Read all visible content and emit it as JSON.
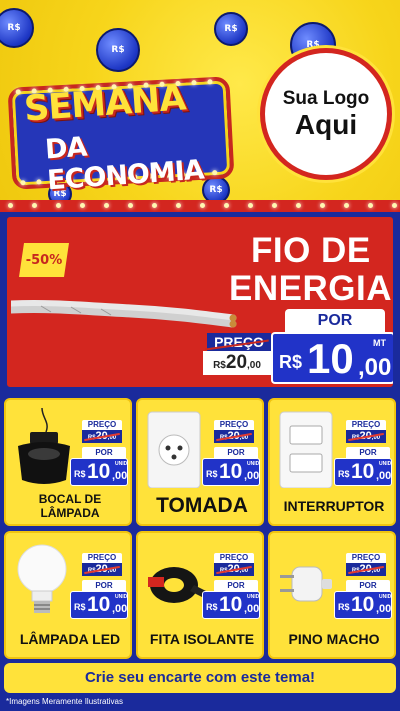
{
  "header": {
    "title_line1": "SEMANA",
    "title_line2": "DA ECONOMIA",
    "logo_line1": "Sua Logo",
    "logo_line2": "Aqui",
    "coin_label": "R$"
  },
  "hero": {
    "discount_badge": "-50%",
    "title_line1": "FIO DE",
    "title_line2": "ENERGIA",
    "por_label": "POR",
    "preco_label": "PREÇO",
    "old_currency": "R$",
    "old_price": "20",
    "old_cents": ",00",
    "currency": "R$",
    "price_int": "10",
    "price_dec": ",00",
    "unit": "MT"
  },
  "products": [
    {
      "name": "BOCAL DE\nLÂMPADA",
      "preco_label": "PREÇO",
      "old_currency": "R$",
      "old_price": "20",
      "old_cents": ",00",
      "por_label": "POR",
      "currency": "R$",
      "price_int": "10",
      "price_dec": ",00",
      "unit": "UNID"
    },
    {
      "name": "TOMADA",
      "preco_label": "PREÇO",
      "old_currency": "R$",
      "old_price": "20",
      "old_cents": ",00",
      "por_label": "POR",
      "currency": "R$",
      "price_int": "10",
      "price_dec": ",00",
      "unit": "UNID"
    },
    {
      "name": "INTERRUPTOR",
      "preco_label": "PREÇO",
      "old_currency": "R$",
      "old_price": "20",
      "old_cents": ",00",
      "por_label": "POR",
      "currency": "R$",
      "price_int": "10",
      "price_dec": ",00",
      "unit": "UNID"
    },
    {
      "name": "LÂMPADA LED",
      "preco_label": "PREÇO",
      "old_currency": "R$",
      "old_price": "20",
      "old_cents": ",00",
      "por_label": "POR",
      "currency": "R$",
      "price_int": "10",
      "price_dec": ",00",
      "unit": "UNID"
    },
    {
      "name": "FITA ISOLANTE",
      "preco_label": "PREÇO",
      "old_currency": "R$",
      "old_price": "20",
      "old_cents": ",00",
      "por_label": "POR",
      "currency": "R$",
      "price_int": "10",
      "price_dec": ",00",
      "unit": "UNID"
    },
    {
      "name": "PINO MACHO",
      "preco_label": "PREÇO",
      "old_currency": "R$",
      "old_price": "20",
      "old_cents": ",00",
      "por_label": "POR",
      "currency": "R$",
      "price_int": "10",
      "price_dec": ",00",
      "unit": "UNID"
    }
  ],
  "footer": {
    "cta": "Crie seu encarte com este tema!",
    "disclaimer": "*Imagens Meramente Ilustrativas"
  },
  "colors": {
    "yellow": "#ffe23a",
    "blue": "#1a2a9c",
    "red": "#d3261f",
    "price_blue": "#2133c8"
  }
}
